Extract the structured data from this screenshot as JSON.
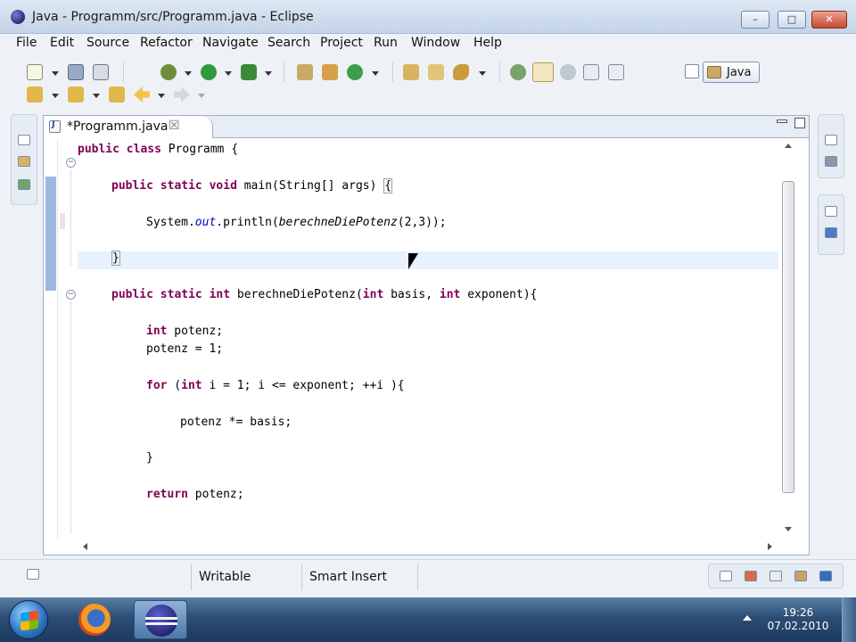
{
  "window": {
    "title": "Java - Programm/src/Programm.java - Eclipse",
    "controls": {
      "minimize": "–",
      "maximize": "□",
      "close": "✕"
    }
  },
  "menu": [
    "File",
    "Edit",
    "Source",
    "Refactor",
    "Navigate",
    "Search",
    "Project",
    "Run",
    "Window",
    "Help"
  ],
  "toolbar": {
    "perspective_label": "Java",
    "icons": [
      "new-icon",
      "save-icon",
      "print-icon",
      "debug-icon",
      "run-icon",
      "external-tools-icon",
      "new-java-project-icon",
      "new-package-icon",
      "new-class-icon",
      "open-type-icon",
      "open-task-icon",
      "search-icon",
      "toggle-mark-occurrences-icon",
      "toggle-highlight-icon",
      "show-whitespace-icon",
      "block-selection-icon",
      "next-annotation-icon",
      "previous-annotation-icon",
      "last-edit-icon",
      "back-icon",
      "forward-icon"
    ]
  },
  "editor": {
    "tab_label": "*Programm.java",
    "tab_close": "☒",
    "code": [
      "public class Programm {",
      "",
      "    public static void main(String[] args) {",
      "",
      "        System.out.println(berechneDiePotenz(2,3));",
      "",
      "    }",
      "",
      "    public static int berechneDiePotenz(int basis, int exponent){",
      "",
      "        int potenz;",
      "        potenz = 1;",
      "",
      "        for (int i = 1; i <= exponent; ++i ){",
      "",
      "            potenz *= basis;",
      "",
      "        }",
      "",
      "        return potenz;"
    ]
  },
  "statusbar": {
    "mode": "Writable",
    "insert_mode": "Smart Insert"
  },
  "taskbar": {
    "time": "19:26",
    "date": "07.02.2010"
  },
  "colors": {
    "keyword": "#7f0055",
    "field": "#0000c0",
    "current_line": "#e8f2fe"
  }
}
